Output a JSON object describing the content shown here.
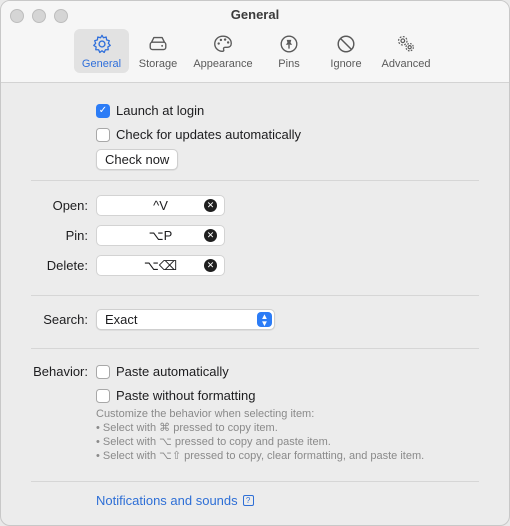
{
  "window": {
    "title": "General"
  },
  "toolbar": {
    "items": [
      {
        "label": "General",
        "icon": "gear-icon",
        "active": true
      },
      {
        "label": "Storage",
        "icon": "drive-icon"
      },
      {
        "label": "Appearance",
        "icon": "palette-icon"
      },
      {
        "label": "Pins",
        "icon": "pin-icon"
      },
      {
        "label": "Ignore",
        "icon": "prohibited-icon"
      },
      {
        "label": "Advanced",
        "icon": "gears-icon"
      }
    ]
  },
  "general": {
    "launch_at_login": {
      "label": "Launch at login",
      "checked": true
    },
    "check_updates": {
      "label": "Check for updates automatically",
      "checked": false
    },
    "check_now_label": "Check now"
  },
  "shortcuts": {
    "open": {
      "label": "Open:",
      "value": "^V"
    },
    "pin": {
      "label": "Pin:",
      "value": "⌥P"
    },
    "delete": {
      "label": "Delete:",
      "value": "⌥⌫"
    }
  },
  "search": {
    "label": "Search:",
    "value": "Exact"
  },
  "behavior": {
    "label": "Behavior:",
    "paste_automatically": {
      "label": "Paste automatically",
      "checked": false
    },
    "paste_without_formatting": {
      "label": "Paste without formatting",
      "checked": false
    },
    "hint_lines": [
      "Customize the behavior when selecting item:",
      "• Select with ⌘ pressed to copy item.",
      "• Select with ⌥ pressed to copy and paste item.",
      "• Select with ⌥⇧ pressed to copy, clear formatting, and paste item."
    ]
  },
  "footer": {
    "link_label": "Notifications and sounds",
    "help_glyph": "?"
  },
  "colors": {
    "accent": "#2c7cf6",
    "link": "#2e6fd6",
    "active_tab": "#2f6fdb"
  }
}
